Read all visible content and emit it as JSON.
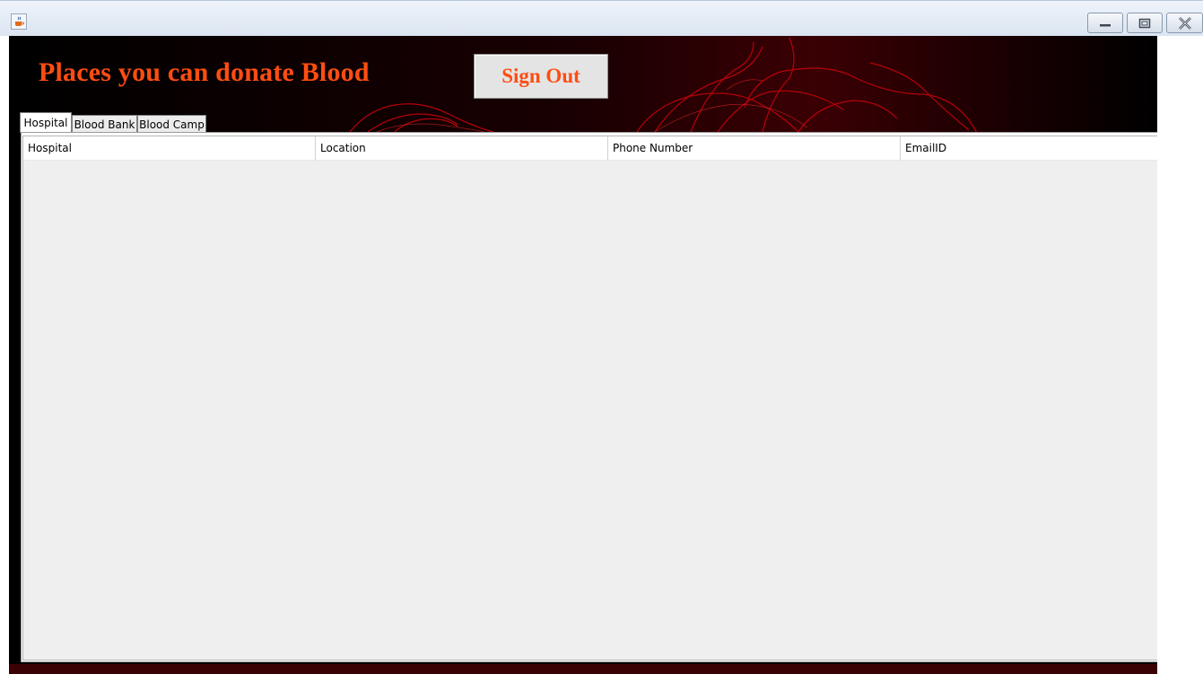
{
  "window": {
    "app_icon": "java-cup-icon",
    "controls": {
      "minimize": "minimize-icon",
      "maximize": "maximize-icon",
      "close": "close-icon"
    }
  },
  "header": {
    "title": "Places you can donate Blood",
    "signout_label": "Sign Out"
  },
  "tabs": [
    {
      "label": "Hospital",
      "active": true
    },
    {
      "label": "Blood Bank",
      "active": false
    },
    {
      "label": "Blood Camp",
      "active": false
    }
  ],
  "table": {
    "columns": [
      "Hospital",
      "Location",
      "Phone Number",
      "EmailID"
    ],
    "rows": []
  },
  "colors": {
    "accent": "#ff4d12",
    "banner_background": "#000000",
    "banner_veins": "#c0000a"
  }
}
